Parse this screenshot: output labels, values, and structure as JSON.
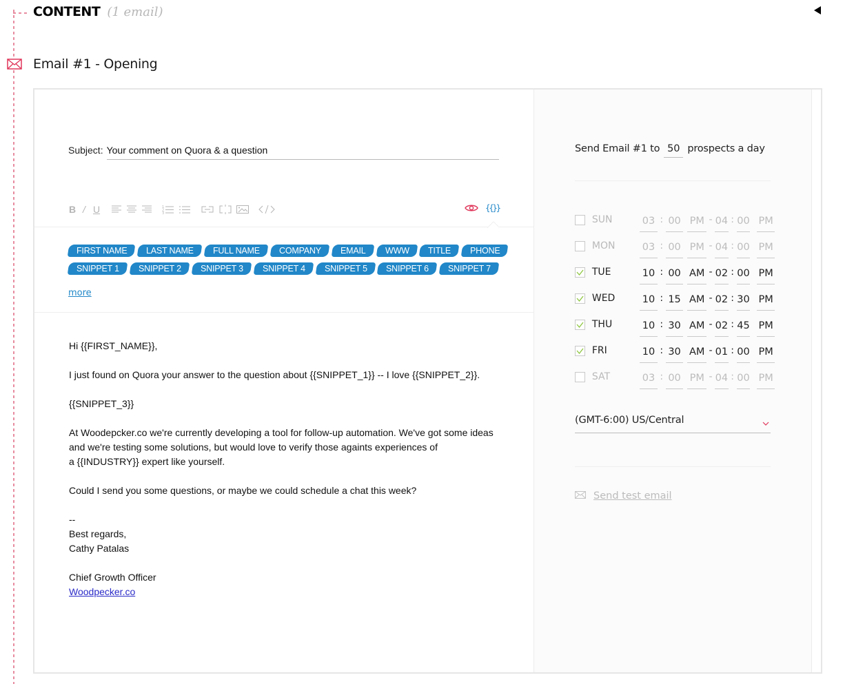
{
  "section": {
    "title": "CONTENT",
    "count_label": "(1 email)",
    "collapse_icon": "triangle-left-icon"
  },
  "email": {
    "icon": "envelope-icon",
    "title": "Email #1 - Opening",
    "subject_label": "Subject:",
    "subject_value": "Your comment on Quora & a question",
    "toolbar": {
      "bold": "B",
      "italic": "/",
      "underline": "U",
      "icons": [
        "align-left-icon",
        "align-center-icon",
        "align-right-icon",
        "ordered-list-icon",
        "unordered-list-icon",
        "link-icon",
        "unlink-icon",
        "image-icon",
        "code-icon",
        "preview-eye-icon",
        "template-braces-icon"
      ],
      "braces_label": "{{}}"
    },
    "tags_row1": [
      "FIRST NAME",
      "LAST NAME",
      "FULL NAME",
      "COMPANY",
      "EMAIL",
      "WWW",
      "TITLE",
      "PHONE"
    ],
    "tags_row2": [
      "SNIPPET 1",
      "SNIPPET 2",
      "SNIPPET 3",
      "SNIPPET 4",
      "SNIPPET 5",
      "SNIPPET 6",
      "SNIPPET 7"
    ],
    "more_label": "more",
    "body": {
      "greeting": "Hi {{FIRST_NAME}},",
      "p1": "I just found on Quora your answer to the question about {{SNIPPET_1}} -- I love {{SNIPPET_2}}.",
      "p2": "{{SNIPPET_3}}",
      "p3_l1": "At Woodepcker.co we're currently developing a tool for follow-up automation. We've got some ideas",
      "p3_l2": "and we're testing some solutions, but would love to verify those againts experiences of",
      "p3_l3": "a {{INDUSTRY}} expert like yourself.",
      "p4": "Could I send you some questions, or maybe we could schedule a chat this week?",
      "sig_dash": "--",
      "sig_regards": "Best regards,",
      "sig_name": "Cathy Patalas",
      "sig_title": "Chief Growth Officer",
      "sig_link": "Woodpecker.co"
    }
  },
  "settings": {
    "quota_prefix": "Send Email #1 to",
    "quota_value": "50",
    "quota_suffix": "prospects a day",
    "days": [
      {
        "day": "SUN",
        "enabled": false,
        "start_h": "03",
        "start_m": "00",
        "start_ampm": "PM",
        "end_h": "04",
        "end_m": "00",
        "end_ampm": "PM"
      },
      {
        "day": "MON",
        "enabled": false,
        "start_h": "03",
        "start_m": "00",
        "start_ampm": "PM",
        "end_h": "04",
        "end_m": "00",
        "end_ampm": "PM"
      },
      {
        "day": "TUE",
        "enabled": true,
        "start_h": "10",
        "start_m": "00",
        "start_ampm": "AM",
        "end_h": "02",
        "end_m": "00",
        "end_ampm": "PM"
      },
      {
        "day": "WED",
        "enabled": true,
        "start_h": "10",
        "start_m": "15",
        "start_ampm": "AM",
        "end_h": "02",
        "end_m": "30",
        "end_ampm": "PM"
      },
      {
        "day": "THU",
        "enabled": true,
        "start_h": "10",
        "start_m": "30",
        "start_ampm": "AM",
        "end_h": "02",
        "end_m": "45",
        "end_ampm": "PM"
      },
      {
        "day": "FRI",
        "enabled": true,
        "start_h": "10",
        "start_m": "30",
        "start_ampm": "AM",
        "end_h": "01",
        "end_m": "00",
        "end_ampm": "PM"
      },
      {
        "day": "SAT",
        "enabled": false,
        "start_h": "03",
        "start_m": "00",
        "start_ampm": "PM",
        "end_h": "04",
        "end_m": "00",
        "end_ampm": "PM"
      }
    ],
    "time_colon": ":",
    "time_dash": "-",
    "timezone": "(GMT-6:00) US/Central",
    "send_test_label": "Send test email"
  },
  "colors": {
    "accent_blue": "#2187c8",
    "accent_red": "#e0365a",
    "check_green": "#8dc63f"
  }
}
